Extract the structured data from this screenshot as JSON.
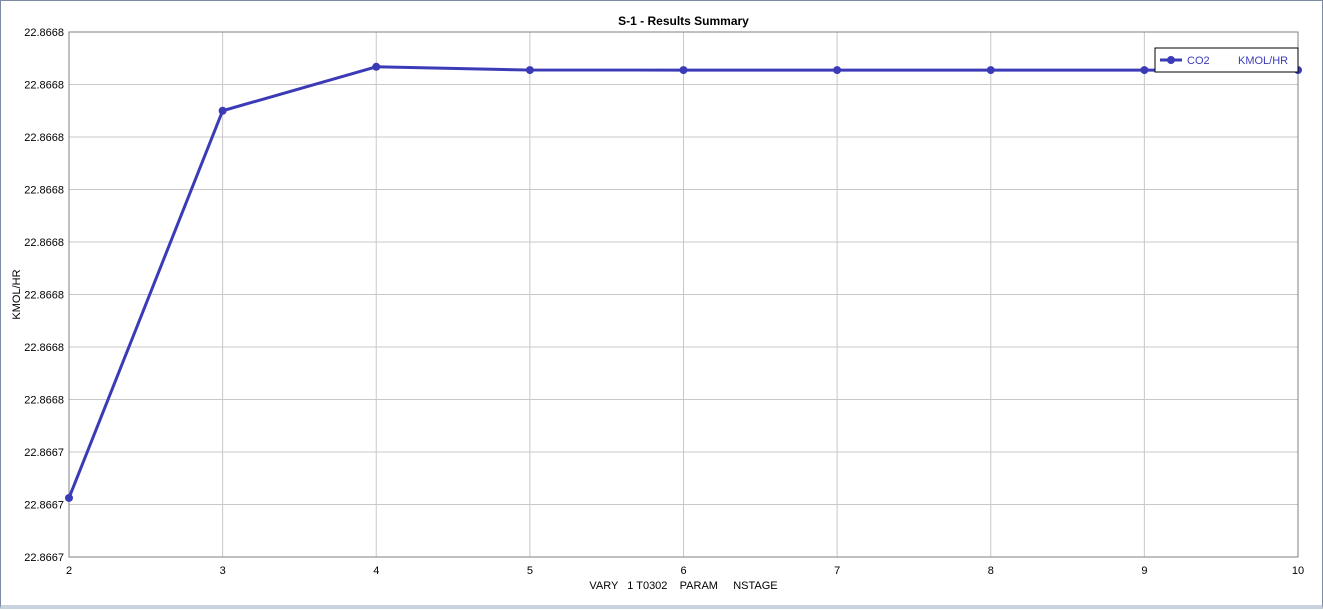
{
  "chart_data": {
    "type": "line",
    "title": "S-1 - Results Summary",
    "xlabel": "VARY   1 T0302    PARAM     NSTAGE",
    "ylabel": "KMOL/HR",
    "x": [
      2,
      3,
      4,
      5,
      6,
      7,
      8,
      9,
      10
    ],
    "xlim": [
      2,
      10
    ],
    "x_ticks": [
      "2",
      "3",
      "4",
      "5",
      "6",
      "7",
      "8",
      "9",
      "10"
    ],
    "ylim": [
      22.86668,
      22.86676
    ],
    "y_ticks": [
      "22.8668",
      "22.8668",
      "22.8668",
      "22.8668",
      "22.8668",
      "22.8668",
      "22.8668",
      "22.8668",
      "22.8667",
      "22.8667",
      "22.8667"
    ],
    "grid": true,
    "legend_position": "top-right",
    "series": [
      {
        "name": "CO2",
        "unit": "KMOL/HR",
        "color": "#3b3bb8",
        "values": [
          22.866689,
          22.866748,
          22.8667547,
          22.8667542,
          22.8667542,
          22.8667542,
          22.8667542,
          22.8667542,
          22.8667542
        ]
      }
    ]
  }
}
